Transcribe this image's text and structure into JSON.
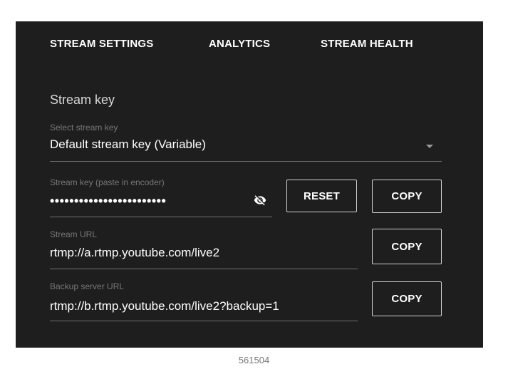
{
  "tabs": [
    {
      "label": "STREAM SETTINGS"
    },
    {
      "label": "ANALYTICS"
    },
    {
      "label": "STREAM HEALTH"
    }
  ],
  "stream_key_section": {
    "title": "Stream key",
    "select": {
      "label": "Select stream key",
      "value": "Default stream key (Variable)"
    },
    "key": {
      "label": "Stream key (paste in encoder)",
      "value": "••••••••••••••••••••••••"
    },
    "reset_label": "RESET",
    "copy_label": "COPY"
  },
  "stream_url": {
    "label": "Stream URL",
    "value": "rtmp://a.rtmp.youtube.com/live2",
    "copy_label": "COPY"
  },
  "backup_url": {
    "label": "Backup server URL",
    "value": "rtmp://b.rtmp.youtube.com/live2?backup=1",
    "copy_label": "COPY"
  },
  "caption": "561504",
  "colors": {
    "panel_bg": "#1e1e1e",
    "text_primary": "#ffffff",
    "text_secondary": "#777777",
    "border": "#cfcfcf"
  },
  "icons": {
    "visibility": "visibility-off-icon",
    "dropdown": "arrow-drop-down-icon"
  }
}
